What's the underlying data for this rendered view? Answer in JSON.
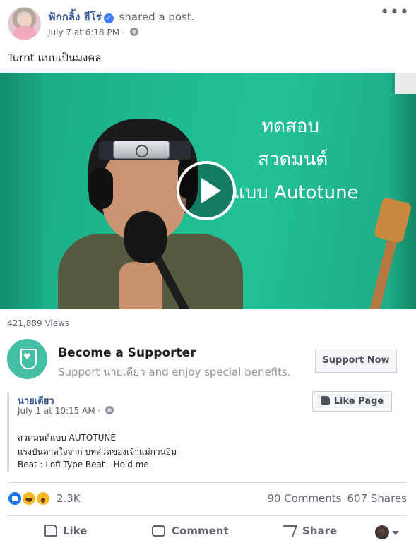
{
  "post": {
    "author": "ฟักกลิ้ง ฮีโร่",
    "action": "shared a post.",
    "timestamp": "July 7 at 6:18 PM",
    "more_icon": "more-dots-icon",
    "text": "Turnt แบบเป็นมงคล"
  },
  "video": {
    "caption_lines": [
      "ทดสอบ",
      "สวดมนต์",
      "แบบ Autotune"
    ],
    "views": "421,889 Views"
  },
  "supporter": {
    "title": "Become a Supporter",
    "subtitle": "Support นายเดียว and enjoy special benefits.",
    "button_label": "Support Now",
    "accent_color": "#44bfa4"
  },
  "shared_post": {
    "page_name": "นายเดียว",
    "timestamp": "July 1 at 10:15 AM · ",
    "like_page_label": "Like Page",
    "lines": [
      "สวดมนต์แบบ AUTOTUNE",
      "แรงบันดาลใจจาก บทสวดของเจ้าแม่กวนอิม",
      "Beat : Lofi Type Beat - Hold me"
    ]
  },
  "stats": {
    "reaction_count": "2.3K",
    "comments": "90 Comments",
    "shares": "607 Shares"
  },
  "actions": {
    "like": "Like",
    "comment": "Comment",
    "share": "Share"
  },
  "colors": {
    "link": "#385898",
    "muted": "#606770",
    "video_bg": "#1fb890"
  }
}
